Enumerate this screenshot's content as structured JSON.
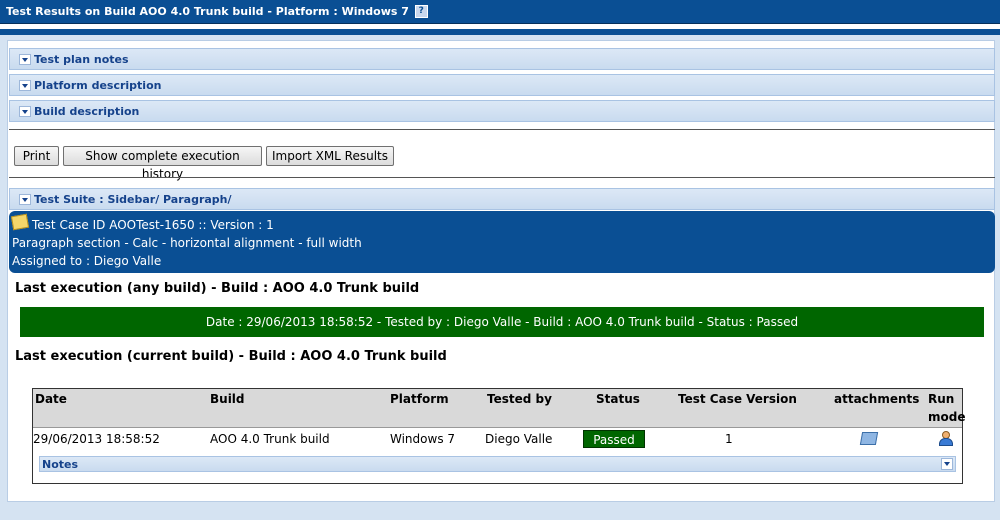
{
  "window": {
    "title": "Test Results on Build AOO 4.0 Trunk build - Platform : Windows 7",
    "help_glyph": "?"
  },
  "sections": {
    "test_plan_notes": "Test plan notes",
    "platform_description": "Platform description",
    "build_description": "Build description",
    "test_suite": "Test Suite : Sidebar/ Paragraph/"
  },
  "buttons": {
    "print": "Print",
    "history": "Show complete execution history",
    "import_xml": "Import XML Results"
  },
  "test_case": {
    "id_line": "Test Case ID AOOTest-1650 :: Version : 1",
    "title": "Paragraph section - Calc - horizontal alignment - full width",
    "assigned": "Assigned to : Diego Valle"
  },
  "last_exec_any": {
    "heading": "Last execution (any build) - Build : AOO 4.0 Trunk build",
    "summary": "Date : 29/06/2013 18:58:52 - Tested by : Diego Valle - Build : AOO 4.0 Trunk build - Status : Passed"
  },
  "last_exec_current": {
    "heading": "Last execution (current build) - Build : AOO 4.0 Trunk build"
  },
  "table": {
    "headers": {
      "date": "Date",
      "build": "Build",
      "platform": "Platform",
      "tested_by": "Tested by",
      "status": "Status",
      "version": "Test Case Version",
      "attachments": "attachments",
      "run": "Run",
      "mode": "mode"
    },
    "row": {
      "date": "29/06/2013 18:58:52",
      "build": "AOO 4.0 Trunk build",
      "platform": "Windows 7",
      "tested_by": "Diego Valle",
      "status": "Passed",
      "version": "1"
    },
    "notes_label": "Notes"
  },
  "colors": {
    "header_blue": "#0a4f94",
    "passed_green": "#006600",
    "section_text": "#15428b"
  }
}
